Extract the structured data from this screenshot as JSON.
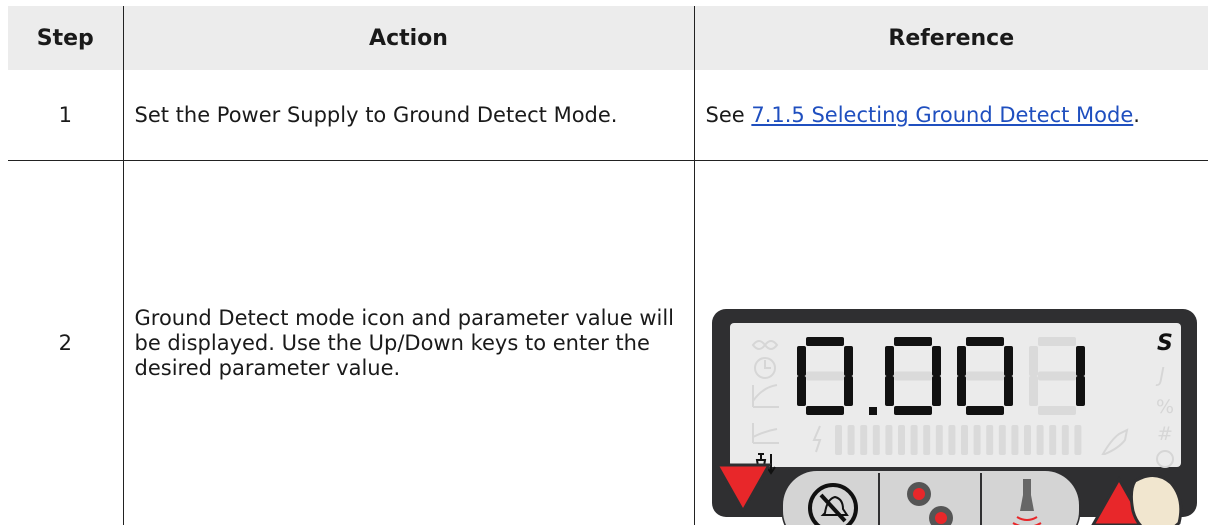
{
  "table": {
    "headers": {
      "step": "Step",
      "action": "Action",
      "reference": "Reference"
    },
    "rows": [
      {
        "step": "1",
        "action": "Set the Power Supply to Ground Detect Mode.",
        "reference_prefix": "See ",
        "reference_link": "7.1.5 Selecting Ground Detect Mode",
        "reference_suffix": "."
      },
      {
        "step": "2",
        "action": "Ground Detect mode icon and parameter value will be displayed. Use the Up/Down keys to enter the desired parameter value.",
        "display": {
          "readout": "0.001",
          "unit_active": "S",
          "unit_inactive": [
            "J",
            "%",
            "#",
            "○"
          ],
          "active_mode_icon": "ground-detect-icon",
          "bargraph_level": 0,
          "buttons": [
            "down-arrow-key",
            "alarm-reset-key",
            "setup-gear-key",
            "test-horn-key",
            "up-arrow-key"
          ],
          "colors": {
            "panel": "#2f2f31",
            "lcd": "#ebebeb",
            "digit_on": "#111111",
            "digit_off": "#dadada",
            "arrow": "#e8272a",
            "key": "#d4d4d4",
            "red_dot": "#e8272a"
          }
        }
      }
    ]
  }
}
